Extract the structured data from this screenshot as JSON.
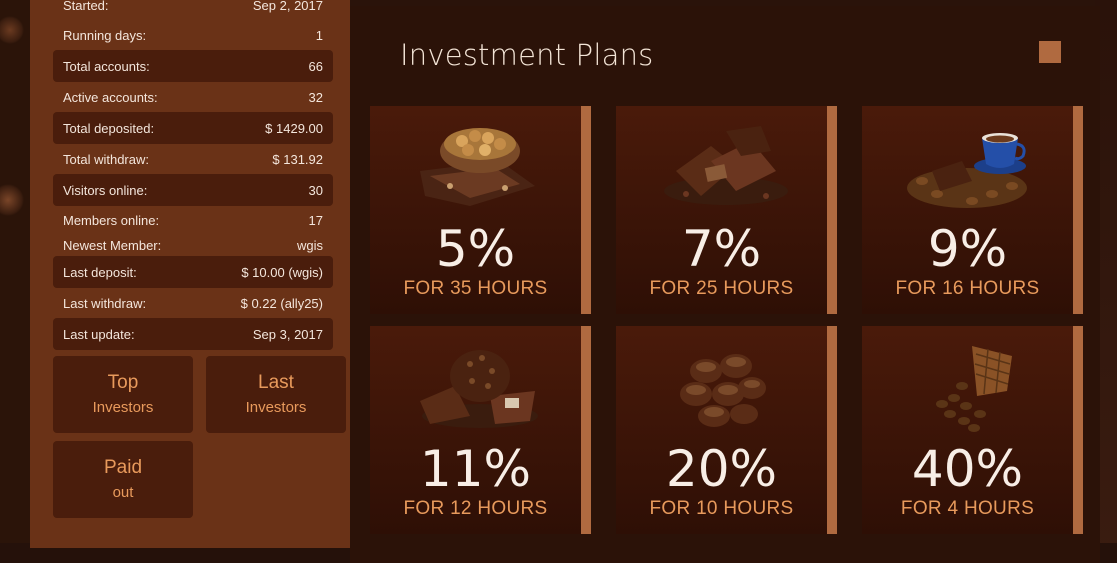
{
  "stats": {
    "rows": [
      {
        "label": "Started:",
        "value": "Sep 2, 2017",
        "dark": false
      },
      {
        "label": "Running days:",
        "value": "1",
        "dark": false
      },
      {
        "label": "Total accounts:",
        "value": "66",
        "dark": true
      },
      {
        "label": "Active accounts:",
        "value": "32",
        "dark": false
      },
      {
        "label": "Total deposited:",
        "value": "$ 1429.00",
        "dark": true
      },
      {
        "label": "Total withdraw:",
        "value": "$ 131.92",
        "dark": false
      },
      {
        "label": "Visitors online:",
        "value": "30",
        "dark": true
      },
      {
        "label": "Members online:",
        "value": "17",
        "dark": false
      },
      {
        "label": "Newest Member:",
        "value": "wgis",
        "dark": false
      },
      {
        "label": "Last deposit:",
        "value": "$ 10.00 (wgis)",
        "dark": true
      },
      {
        "label": "Last withdraw:",
        "value": "$ 0.22 (ally25)",
        "dark": false
      },
      {
        "label": "Last update:",
        "value": "Sep 3, 2017",
        "dark": true
      }
    ]
  },
  "buttons": {
    "top_investors": {
      "line1": "Top",
      "line2": "Investors"
    },
    "last_investors": {
      "line1": "Last",
      "line2": "Investors"
    },
    "paid_out": {
      "line1": "Paid",
      "line2": "out"
    }
  },
  "main": {
    "title": "Investment Plans",
    "plans": [
      {
        "percent": "5%",
        "duration": "FOR 35 HOURS",
        "image": "hazelnut-chocolate-icon"
      },
      {
        "percent": "7%",
        "duration": "FOR 25 HOURS",
        "image": "chocolate-pieces-icon"
      },
      {
        "percent": "9%",
        "duration": "FOR 16 HOURS",
        "image": "coffee-cup-beans-icon"
      },
      {
        "percent": "11%",
        "duration": "FOR 12 HOURS",
        "image": "chocolate-truffle-icon"
      },
      {
        "percent": "20%",
        "duration": "FOR 10 HOURS",
        "image": "chocolate-candies-icon"
      },
      {
        "percent": "40%",
        "duration": "FOR 4 HOURS",
        "image": "coffee-sack-beans-icon"
      }
    ]
  },
  "colors": {
    "accent": "#b06a40",
    "accent_text": "#e89a5c",
    "panel": "#6a3217",
    "panel_dark": "#4a1d0c"
  }
}
